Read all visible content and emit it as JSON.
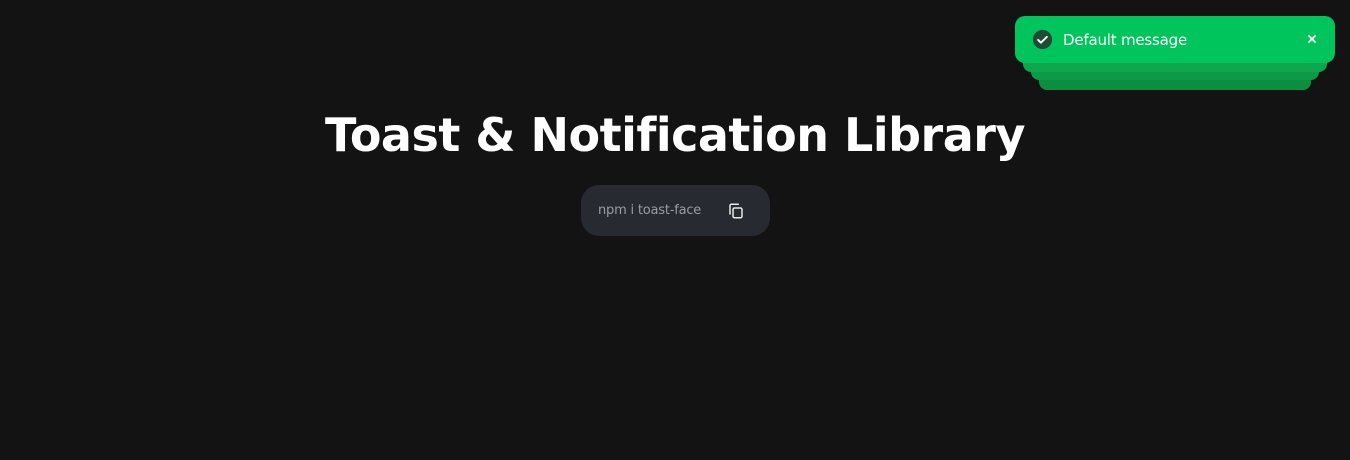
{
  "header": {
    "title": "Toast & Notification Library"
  },
  "install": {
    "command": "npm i toast-face",
    "copy_icon": "copy-icon"
  },
  "toast": {
    "message": "Default message",
    "status_icon": "check-circle-icon",
    "close_icon": "close-icon",
    "close_label": "×",
    "stacked_count": 4,
    "color": "#00c55d"
  },
  "theme": {
    "background": "#131313",
    "pill_background": "#272a31",
    "title_color": "#ffffff"
  }
}
